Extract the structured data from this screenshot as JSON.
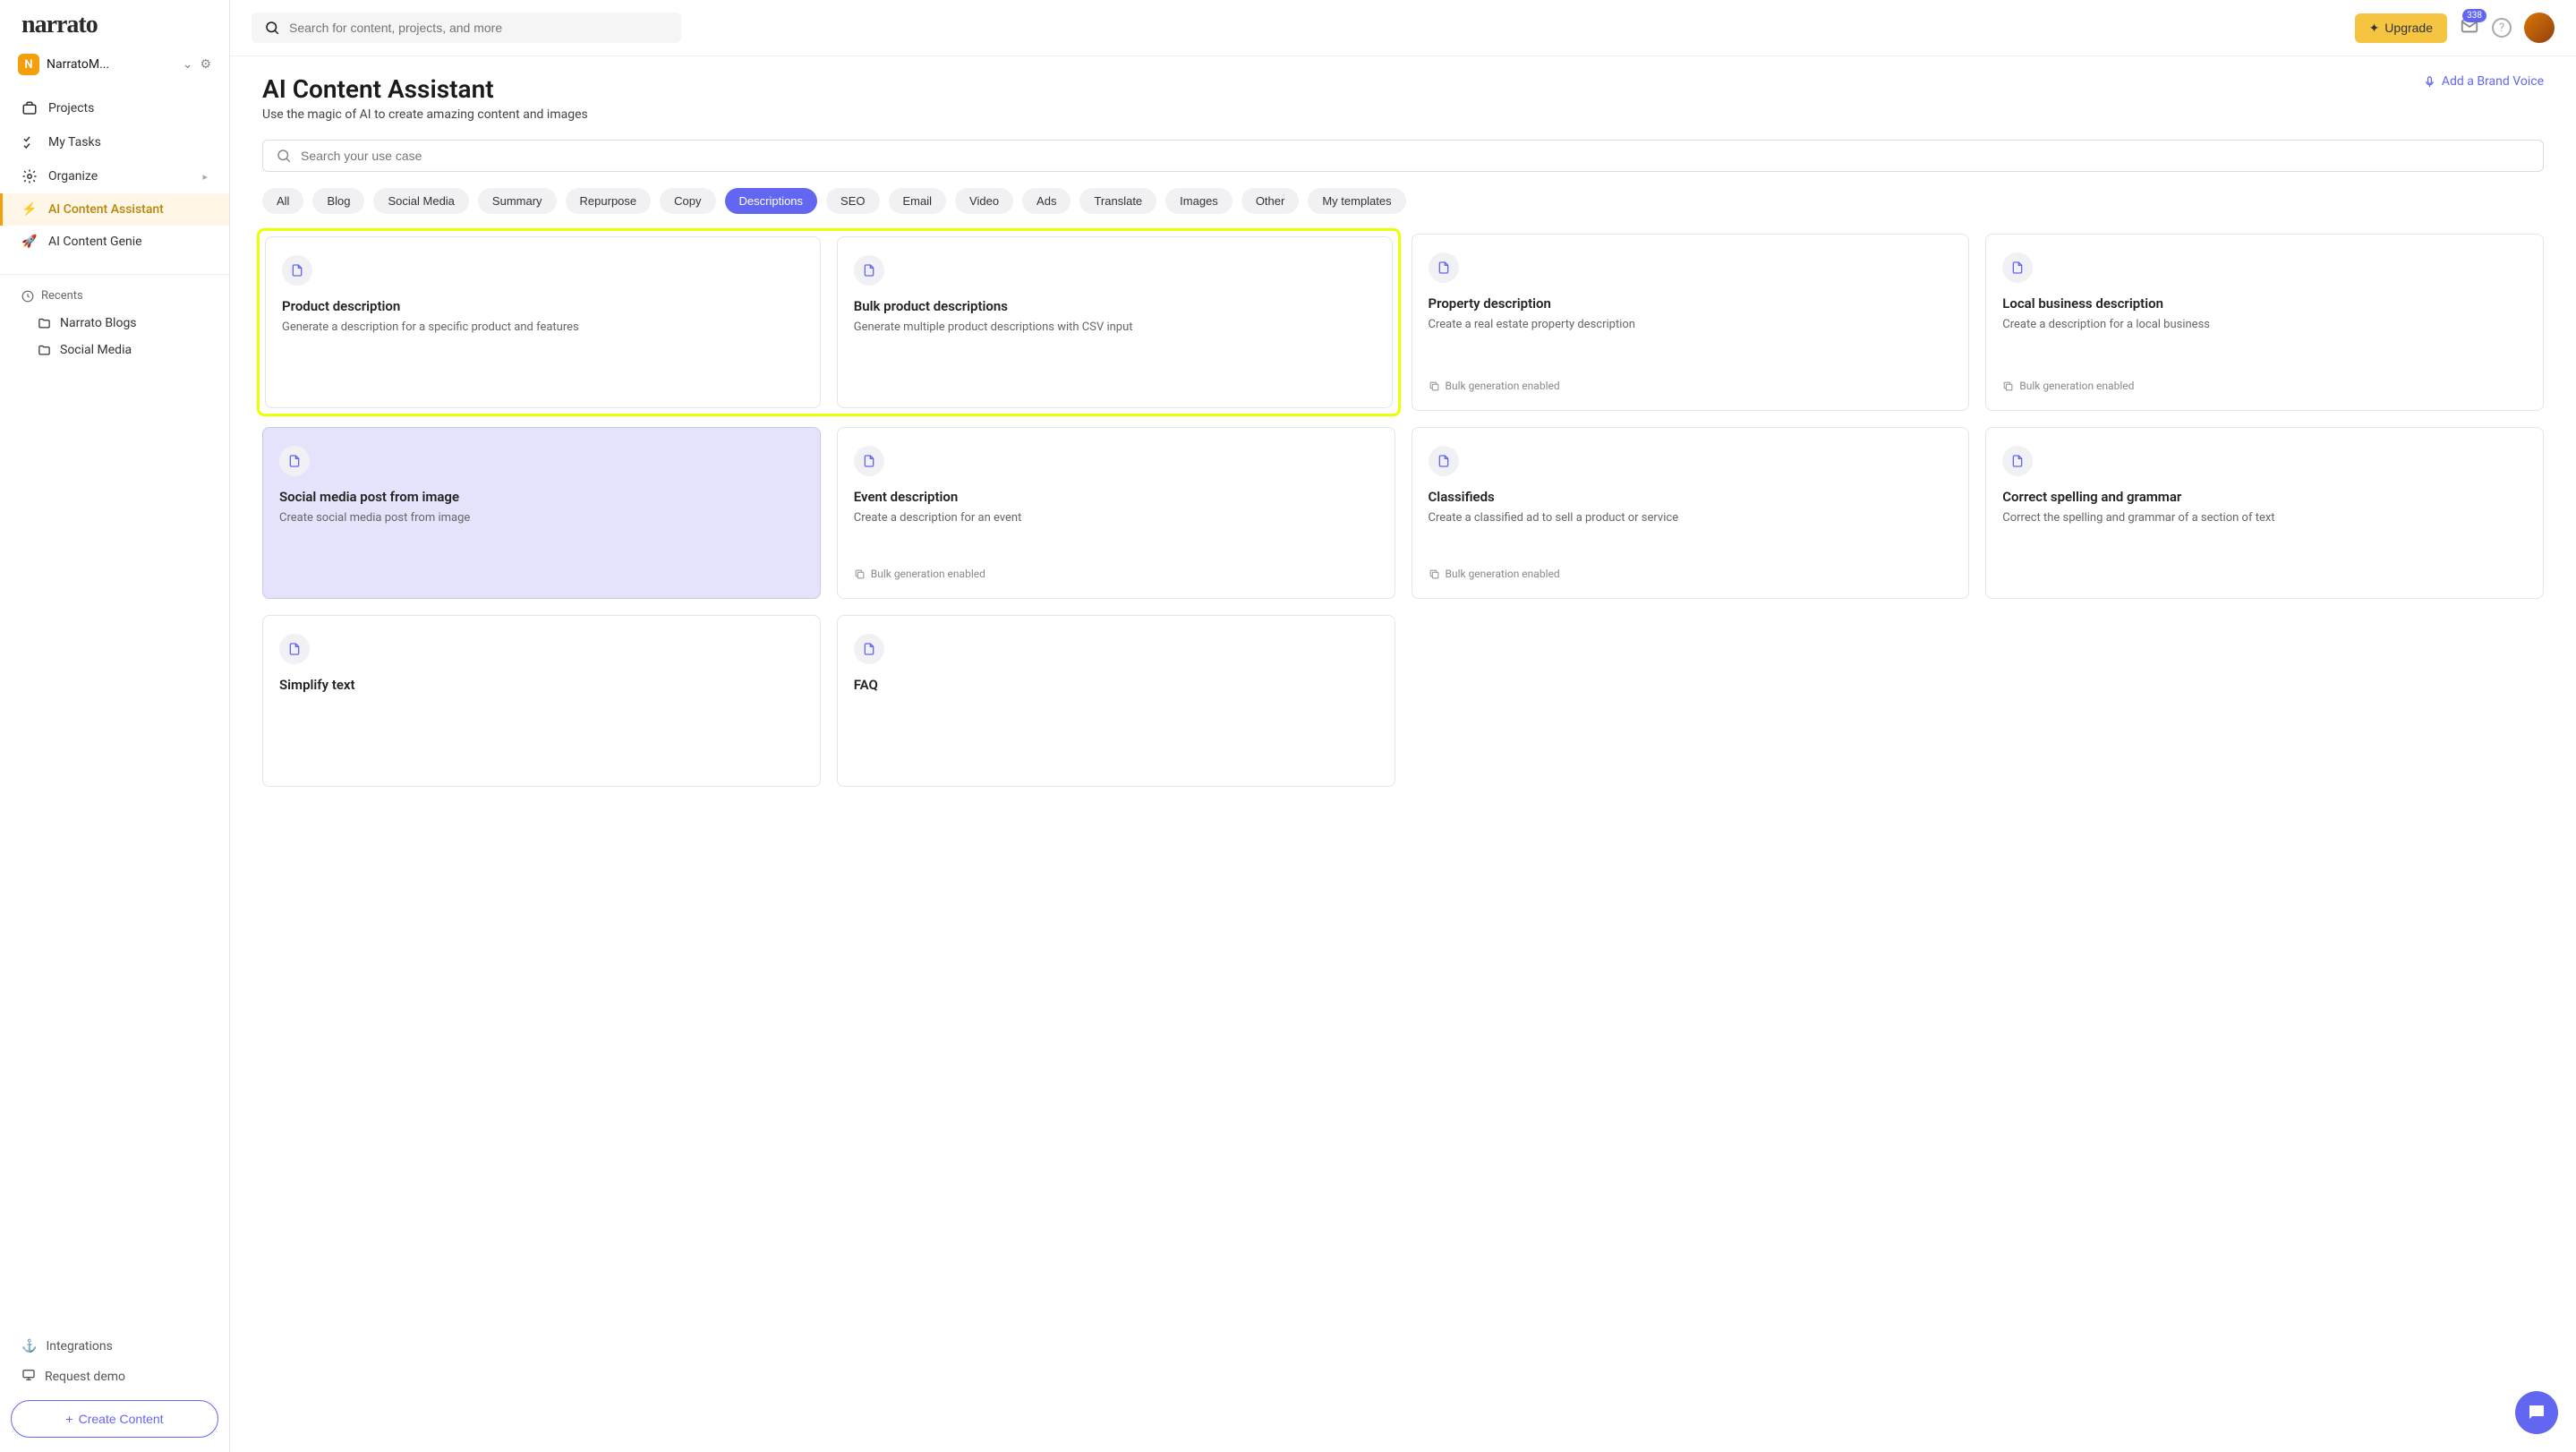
{
  "logo": "narrato",
  "workspace": {
    "initial": "N",
    "name": "NarratoM..."
  },
  "nav": {
    "projects": "Projects",
    "tasks": "My Tasks",
    "organize": "Organize",
    "assistant": "AI Content Assistant",
    "genie": "AI Content Genie"
  },
  "recents": {
    "header": "Recents",
    "items": [
      "Narrato Blogs",
      "Social Media"
    ]
  },
  "footer": {
    "integrations": "Integrations",
    "demo": "Request demo",
    "create": "Create Content"
  },
  "topbar": {
    "search_placeholder": "Search for content, projects, and more",
    "upgrade": "Upgrade",
    "notif_count": "338"
  },
  "header": {
    "title": "AI Content Assistant",
    "subtitle": "Use the magic of AI to create amazing content and images",
    "brand_voice": "Add a Brand Voice"
  },
  "usecase_search_placeholder": "Search your use case",
  "pills": [
    "All",
    "Blog",
    "Social Media",
    "Summary",
    "Repurpose",
    "Copy",
    "Descriptions",
    "SEO",
    "Email",
    "Video",
    "Ads",
    "Translate",
    "Images",
    "Other",
    "My templates"
  ],
  "pill_active_index": 6,
  "bulk_label": "Bulk generation enabled",
  "cards": [
    {
      "title": "Product description",
      "desc": "Generate a description for a specific product and features",
      "bulk": false,
      "highlight": true
    },
    {
      "title": "Bulk product descriptions",
      "desc": "Generate multiple product descriptions with CSV input",
      "bulk": false,
      "highlight": true
    },
    {
      "title": "Property description",
      "desc": "Create a real estate property description",
      "bulk": true
    },
    {
      "title": "Local business description",
      "desc": "Create a description for a local business",
      "bulk": true
    },
    {
      "title": "Social media post from image",
      "desc": "Create social media post from image",
      "bulk": false,
      "hovered": true
    },
    {
      "title": "Event description",
      "desc": "Create a description for an event",
      "bulk": true
    },
    {
      "title": "Classifieds",
      "desc": "Create a classified ad to sell a product or service",
      "bulk": true
    },
    {
      "title": "Correct spelling and grammar",
      "desc": "Correct the spelling and grammar of a section of text",
      "bulk": false
    },
    {
      "title": "Simplify text",
      "desc": "",
      "bulk": false
    },
    {
      "title": "FAQ",
      "desc": "",
      "bulk": false
    }
  ]
}
